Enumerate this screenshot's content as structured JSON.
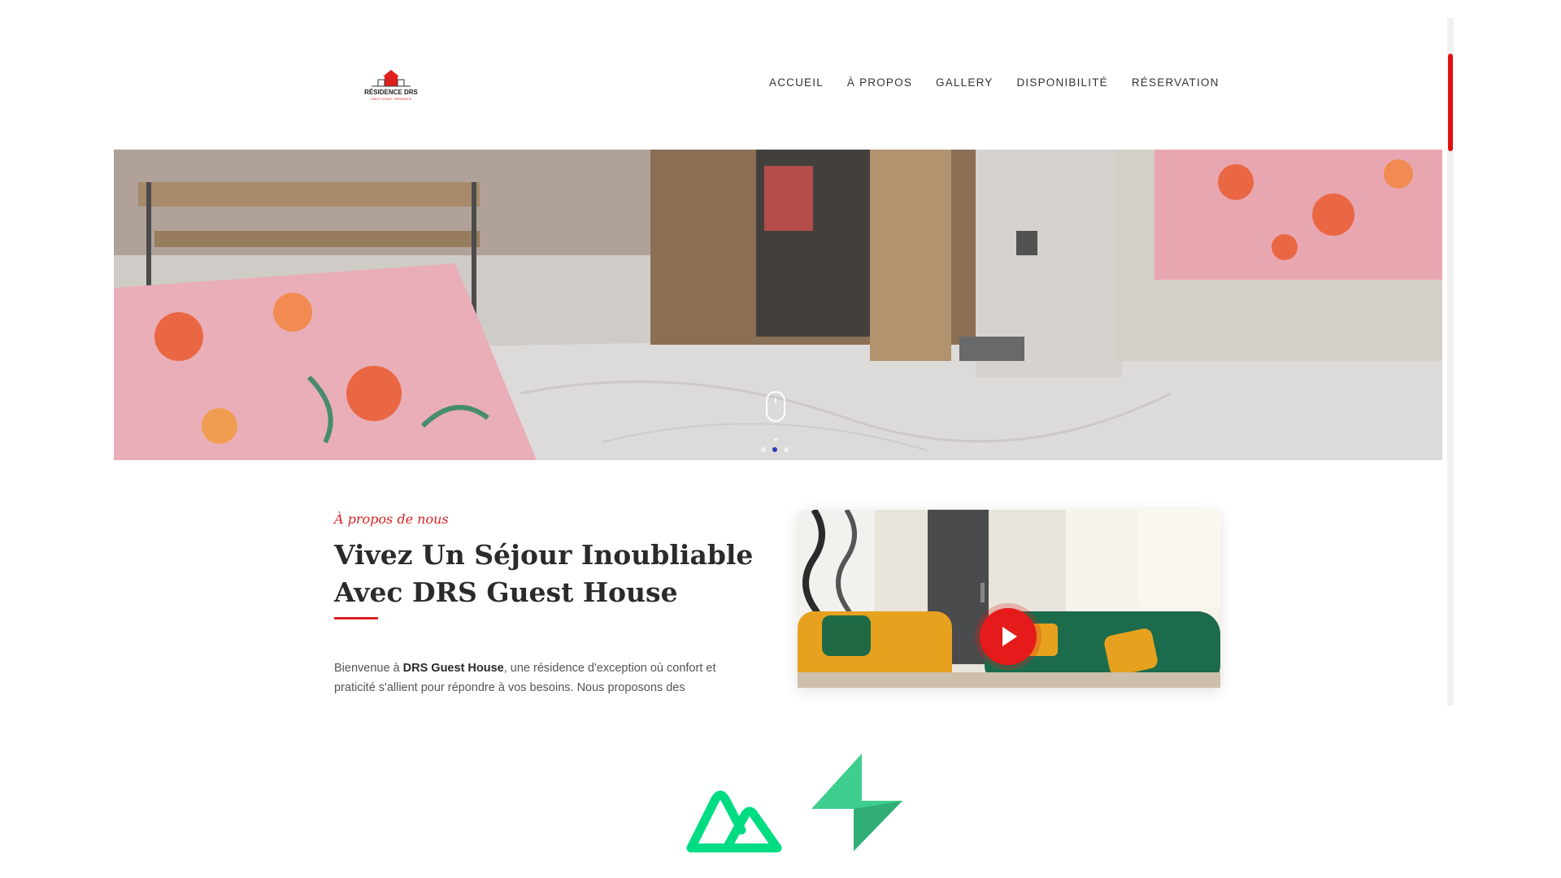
{
  "logo": {
    "name": "RÉSIDENCE DRS",
    "tagline": "GUEST HOUSE · RESIDENCE"
  },
  "nav": {
    "items": [
      "ACCUEIL",
      "À PROPOS",
      "GALLERY",
      "DISPONIBILITÉ",
      "RÉSERVATION"
    ]
  },
  "hero": {
    "slide_count": 3,
    "active_slide": 2
  },
  "about": {
    "kicker": "À propos de nous",
    "title": "Vivez Un Séjour Inoubliable Avec DRS Guest House",
    "intro_prefix": "Bienvenue à ",
    "intro_brand": "DRS Guest House",
    "intro_suffix": ", une résidence d'exception où confort et praticité s'allient pour répondre à vos besoins. Nous proposons des"
  },
  "colors": {
    "accent": "#e01f1f",
    "nuxt_green": "#00DC82",
    "supabase_green": "#3ECF8E"
  },
  "icons": {
    "play": "play-icon",
    "scroll": "mouse-scroll-icon",
    "nuxt": "nuxt-logo",
    "supabase": "supabase-logo"
  }
}
